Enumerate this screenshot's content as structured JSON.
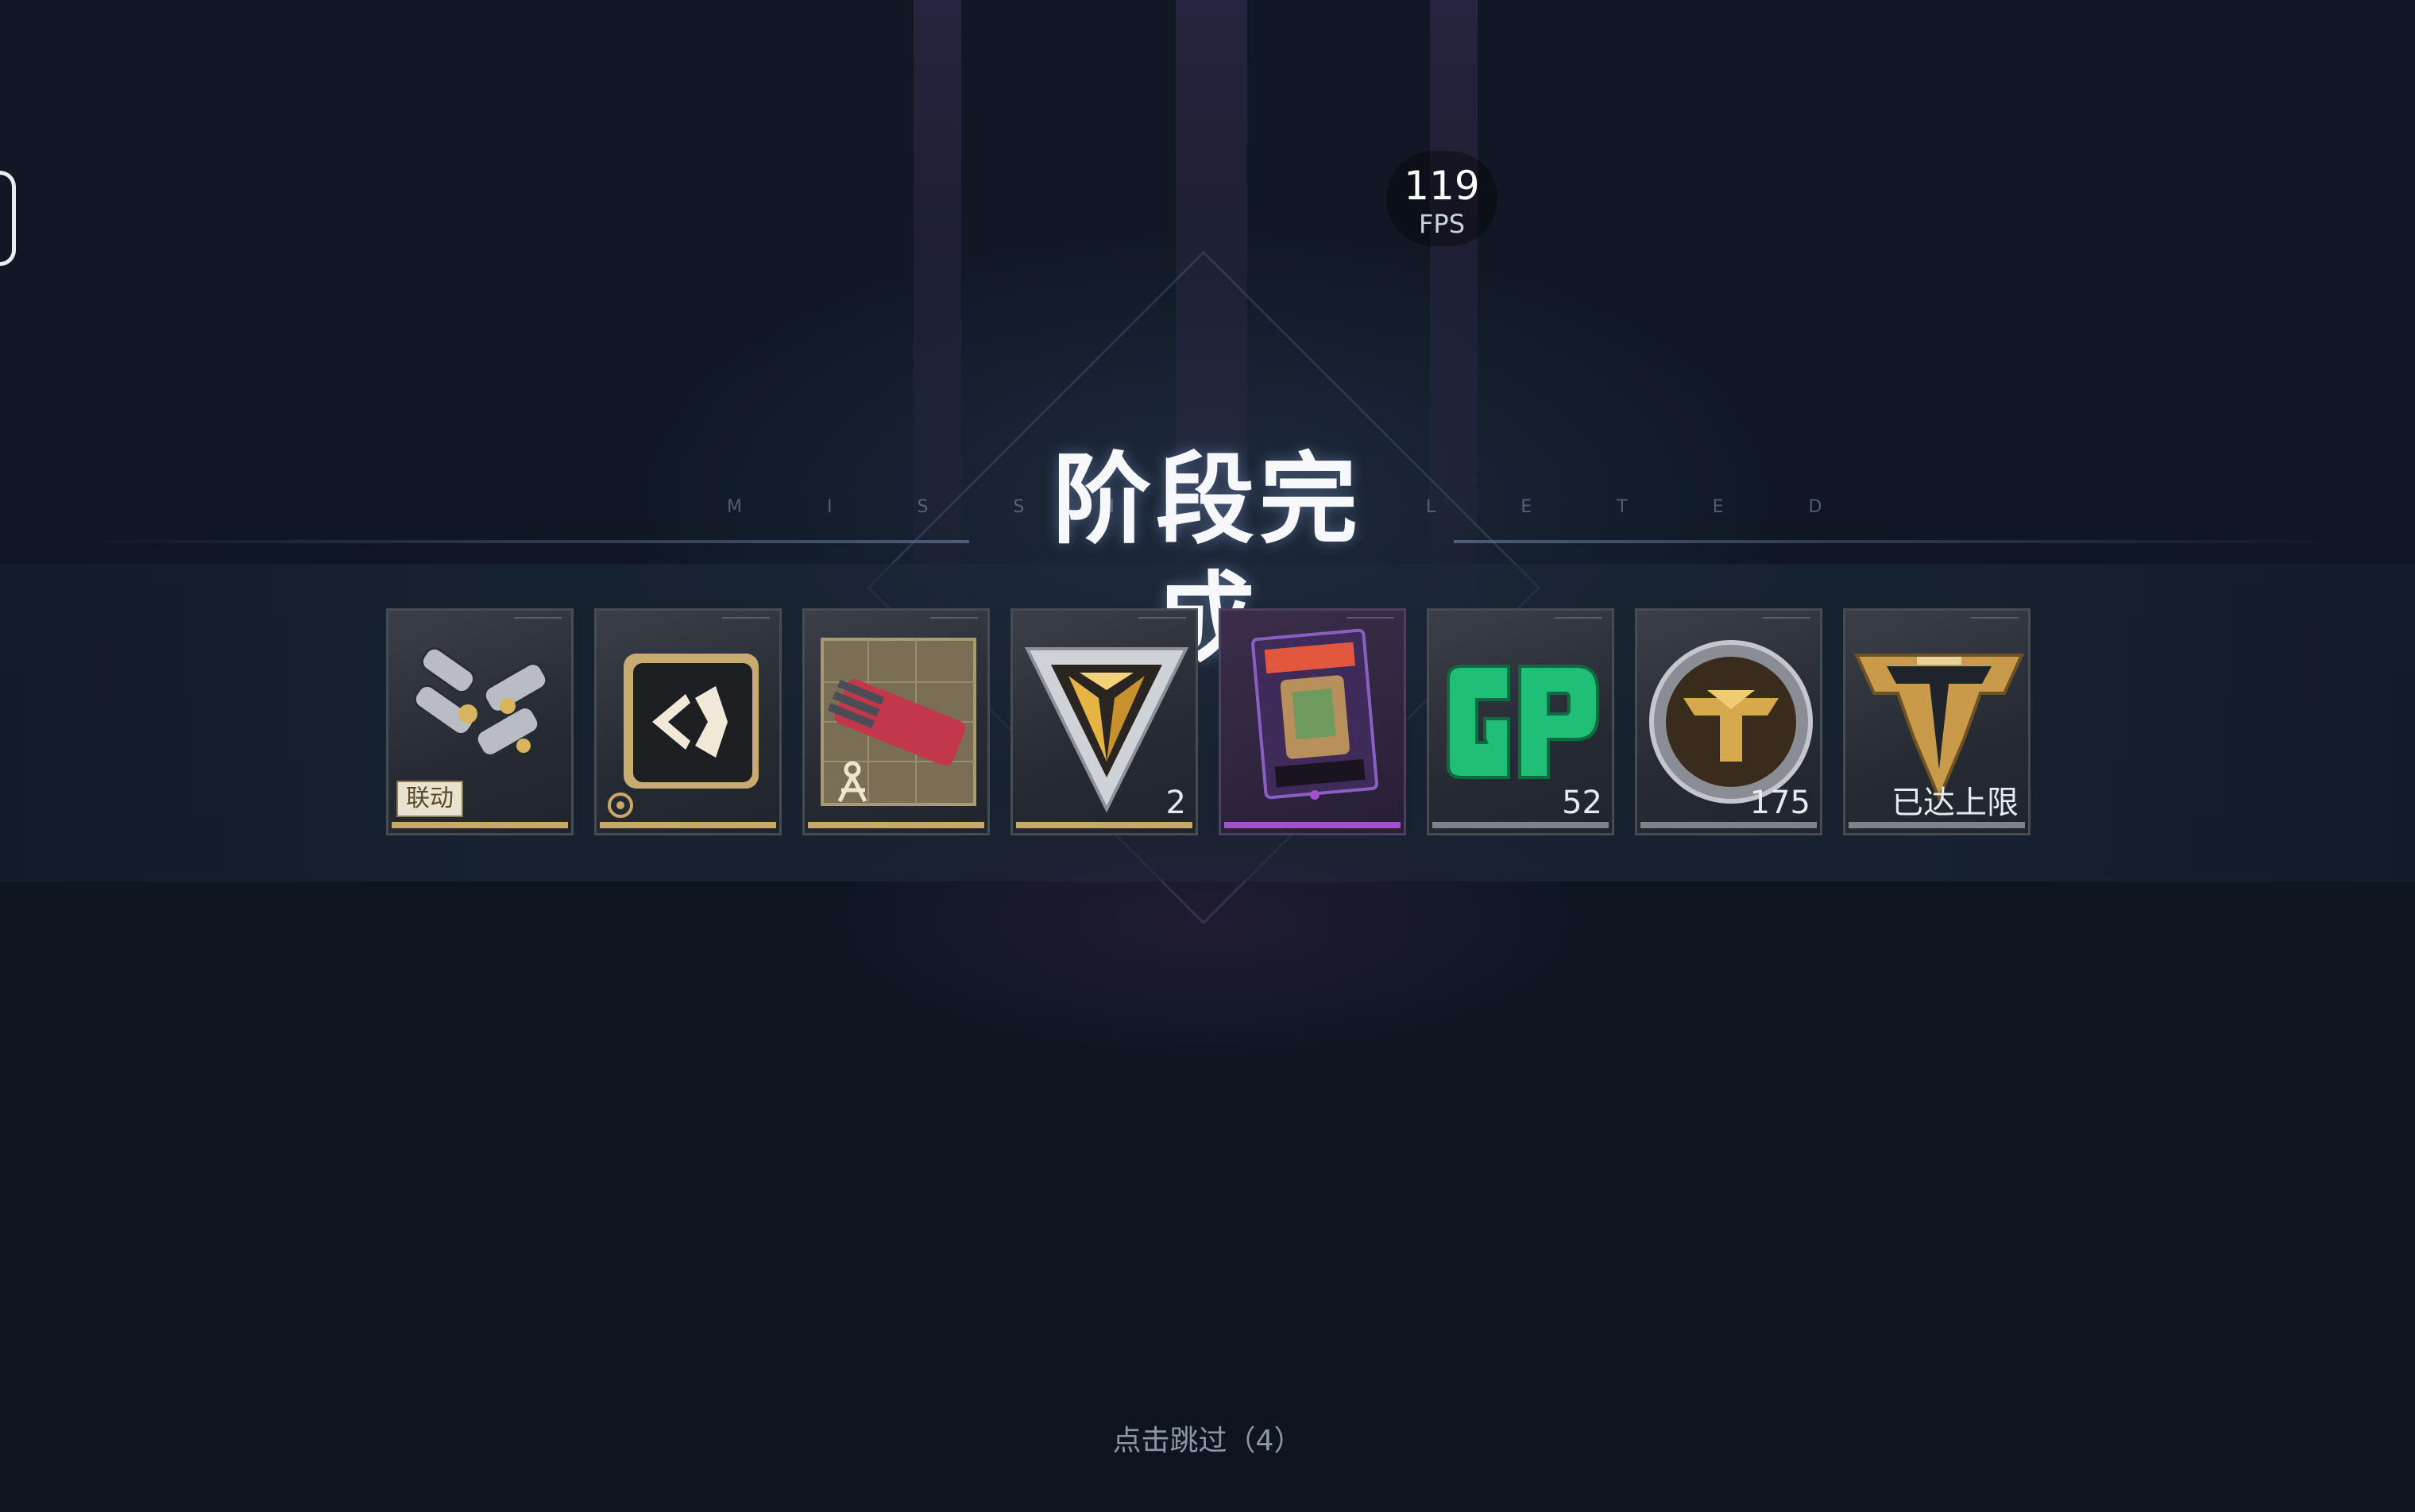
{
  "hud": {
    "fps_value": "119",
    "fps_label": "FPS"
  },
  "header": {
    "title": "阶段完成",
    "subtitle_left": "M I S S I",
    "subtitle_right": "L E T E D"
  },
  "rewards": [
    {
      "name": "reward-gauntlets",
      "icon": "gauntlet-skin-icon",
      "tag": "联动",
      "rarity_color": "#c9a868"
    },
    {
      "name": "reward-emblem",
      "icon": "emblem-badge-icon",
      "rarity_color": "#c9a868"
    },
    {
      "name": "reward-weapon-blueprint",
      "icon": "weapon-blueprint-icon",
      "rarity_color": "#c9a868"
    },
    {
      "name": "reward-triangle-token",
      "icon": "triangle-token-icon",
      "count": "2",
      "rarity_color": "#c9a868"
    },
    {
      "name": "reward-vending-card",
      "icon": "vending-machine-card-icon",
      "rarity_color": "#a34fd0"
    },
    {
      "name": "reward-gp",
      "icon": "gp-currency-icon",
      "count": "52",
      "rarity_color": "#7d838d"
    },
    {
      "name": "reward-coin",
      "icon": "gold-coin-icon",
      "count": "175",
      "rarity_color": "#7d838d"
    },
    {
      "name": "reward-battle-pass",
      "icon": "battle-pass-icon",
      "count": "已达上限",
      "rarity_color": "#7d838d"
    }
  ],
  "footer": {
    "skip_text": "点击跳过（4）"
  },
  "colors": {
    "background": "#0f1723",
    "gold": "#c9a868",
    "purple": "#a34fd0",
    "green": "#1fbf77"
  }
}
